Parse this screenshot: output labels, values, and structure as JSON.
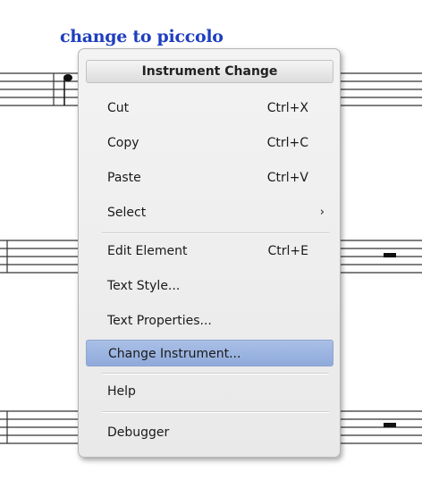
{
  "score": {
    "staff_title": "change to piccolo"
  },
  "context_menu": {
    "title": "Instrument Change",
    "items": [
      {
        "label": "Cut",
        "shortcut": "Ctrl+X"
      },
      {
        "label": "Copy",
        "shortcut": "Ctrl+C"
      },
      {
        "label": "Paste",
        "shortcut": "Ctrl+V"
      },
      {
        "label": "Select",
        "submenu_arrow": "›"
      },
      {
        "label": "Edit Element",
        "shortcut": "Ctrl+E"
      },
      {
        "label": "Text Style..."
      },
      {
        "label": "Text Properties..."
      },
      {
        "label": "Change Instrument...",
        "highlighted": true
      },
      {
        "label": "Help"
      },
      {
        "label": "Debugger"
      }
    ]
  },
  "colors": {
    "staff_title": "#1f3fbf",
    "highlight": "#8faadb",
    "menu_background": "#f0f0f0"
  }
}
